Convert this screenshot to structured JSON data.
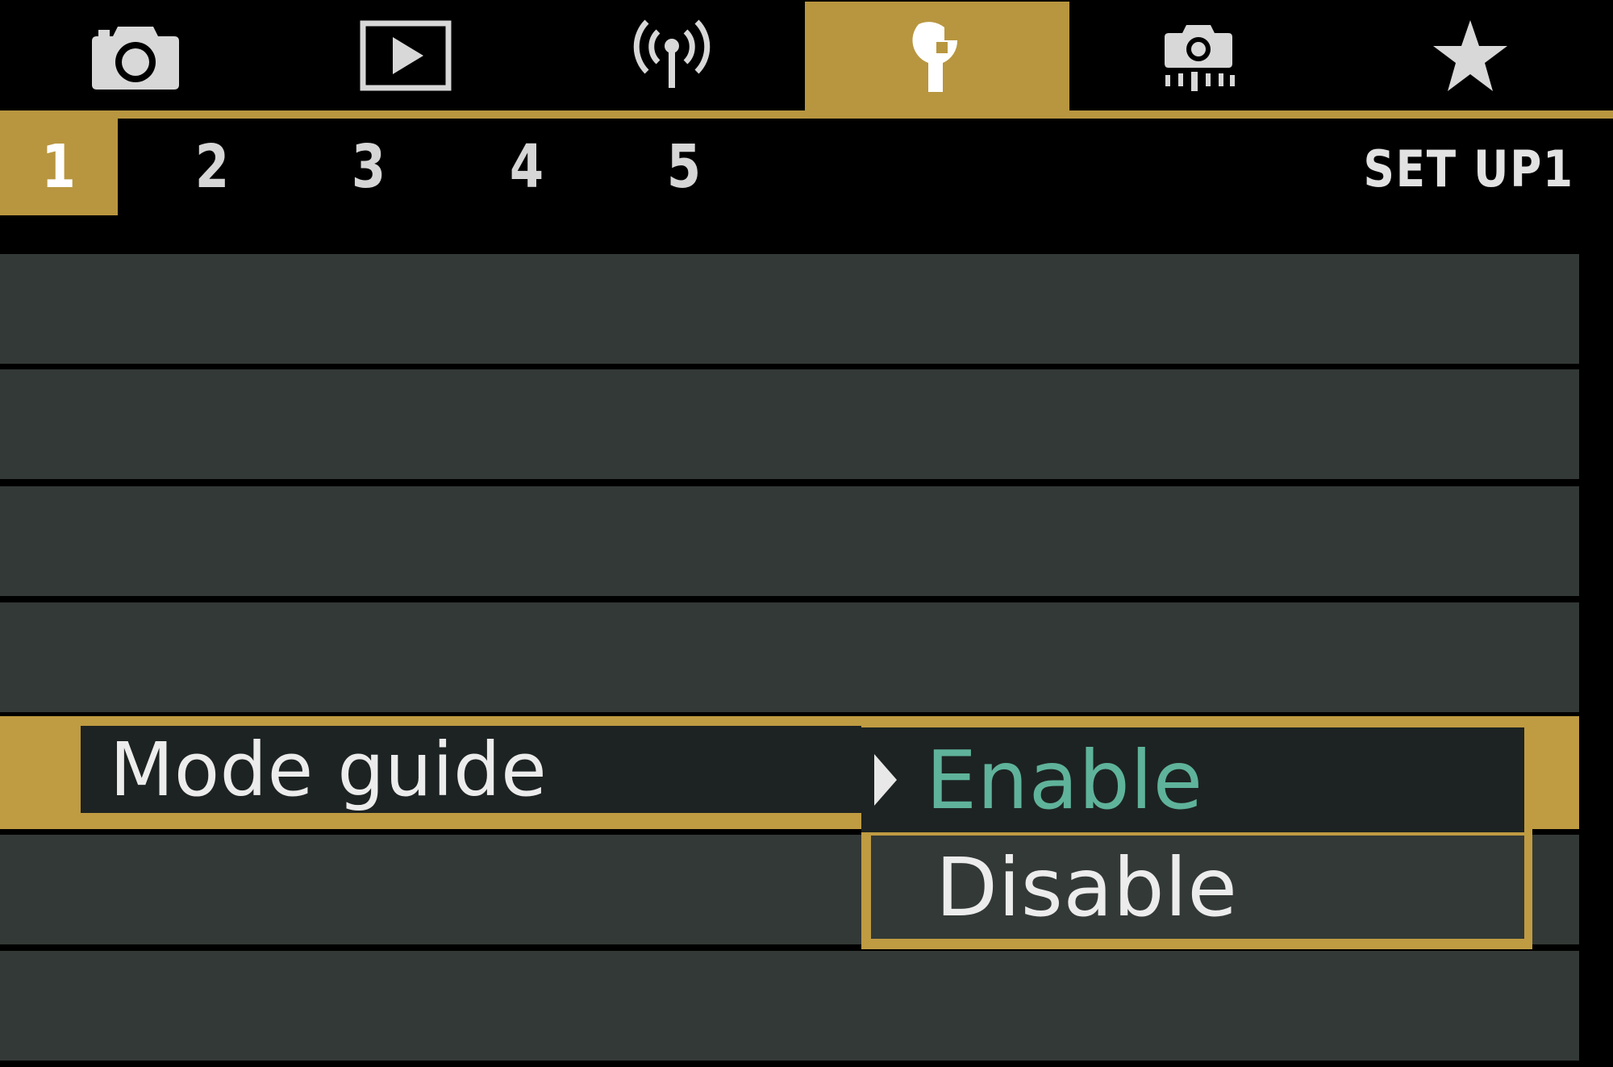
{
  "main_tabs": [
    {
      "icon": "camera-icon",
      "active": false
    },
    {
      "icon": "playback-icon",
      "active": false
    },
    {
      "icon": "wireless-icon",
      "active": false
    },
    {
      "icon": "wrench-icon",
      "active": true
    },
    {
      "icon": "custom-shooting-icon",
      "active": false
    },
    {
      "icon": "star-icon",
      "active": false
    }
  ],
  "sub_tabs": {
    "items": [
      "1",
      "2",
      "3",
      "4",
      "5"
    ],
    "active_index": 0,
    "page_label": "SET UP1"
  },
  "menu": {
    "selected_item": "Mode guide",
    "options": [
      "Enable",
      "Disable"
    ],
    "current_option": "Enable"
  },
  "colors": {
    "accent": "#b8963f",
    "row_background": "#333936",
    "highlight_background": "#1d2322",
    "selected_option_text": "#5fb39a"
  }
}
